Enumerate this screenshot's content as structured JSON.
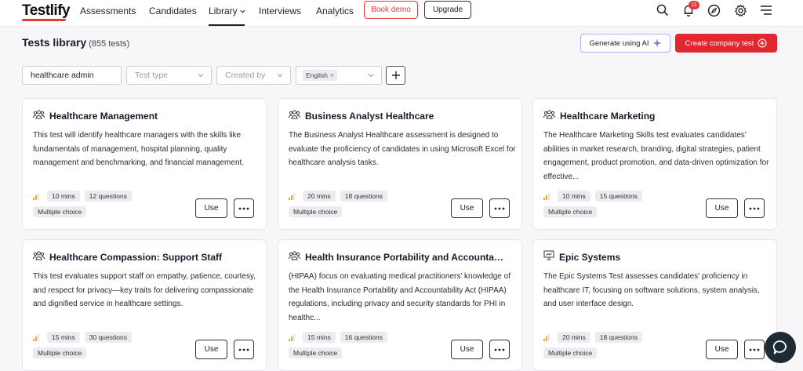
{
  "brand": {
    "name": "Testlify",
    "accent": "#e23b3b"
  },
  "nav": {
    "items": [
      {
        "label": "Assessments"
      },
      {
        "label": "Candidates"
      },
      {
        "label": "Library"
      },
      {
        "label": "Interviews"
      },
      {
        "label": "Analytics"
      }
    ],
    "book_demo": "Book demo",
    "upgrade": "Upgrade",
    "notification_count": "11",
    "icons": [
      "search-icon",
      "bell-icon",
      "compass-icon",
      "gear-icon",
      "menu-icon"
    ]
  },
  "header": {
    "title": "Tests library",
    "count": "(855 tests)",
    "generate_ai": "Generate using AI",
    "create_test": "Create company test"
  },
  "filters": {
    "search_value": "healthcare admin",
    "test_type_placeholder": "Test type",
    "created_by_placeholder": "Created by",
    "language_chip": "English"
  },
  "cards": [
    {
      "title": "Healthcare Management",
      "icon": "group-icon",
      "description": "This test will identify healthcare managers with the skills like fundamentals of management, hospital planning, quality management and benchmarking, and financial management.",
      "duration": "10 mins",
      "questions": "12 questions",
      "type": "Multiple choice",
      "use": "Use"
    },
    {
      "title": "Business Analyst Healthcare",
      "icon": "group-icon",
      "description": "The Business Analyst Healthcare assessment is designed to evaluate the proficiency of candidates in using Microsoft Excel for healthcare analysis tasks.",
      "duration": "20 mins",
      "questions": "18 questions",
      "type": "Multiple choice",
      "use": "Use"
    },
    {
      "title": "Healthcare Marketing",
      "icon": "group-icon",
      "description": "The Healthcare Marketing Skills test evaluates candidates' abilities in market research, branding, digital strategies, patient engagement, product promotion, and data-driven optimization for effective...",
      "duration": "10 mins",
      "questions": "15 questions",
      "type": "Multiple choice",
      "use": "Use"
    },
    {
      "title": "Healthcare Compassion: Support Staff",
      "icon": "group-icon",
      "description": "This test evaluates support staff on empathy, patience, courtesy, and respect for privacy—key traits for delivering compassionate and dignified service in healthcare settings.",
      "duration": "15 mins",
      "questions": "30 questions",
      "type": "Multiple choice",
      "use": "Use"
    },
    {
      "title": "Health Insurance Portability and Accountabil...",
      "icon": "group-icon",
      "description": "(HIPAA) focus on evaluating medical practitioners' knowledge of the Health Insurance Portability and Accountability Act (HIPAA) regulations, including privacy and security standards for PHI in healthc...",
      "duration": "15 mins",
      "questions": "16 questions",
      "type": "Multiple choice",
      "use": "Use"
    },
    {
      "title": "Epic Systems",
      "icon": "presentation-icon",
      "description": "The Epic Systems Test assesses candidates' proficiency in healthcare IT, focusing on software solutions, system analysis, and user interface design.",
      "duration": "20 mins",
      "questions": "18 questions",
      "type": "Multiple choice",
      "use": "Use"
    }
  ]
}
